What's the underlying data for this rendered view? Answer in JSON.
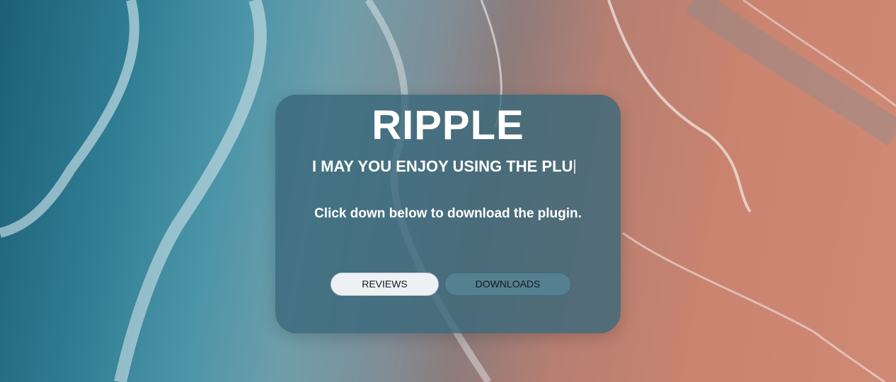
{
  "hero": {
    "title": "RIPPLE",
    "typing_text": "I MAY YOU ENJOY USING THE PLU",
    "description": "Click down below to download the plugin.",
    "background": "beach-waves-photo"
  },
  "buttons": {
    "reviews_label": "REVIEWS",
    "downloads_label": "DOWNLOADS"
  },
  "colors": {
    "ocean": "#2f7d93",
    "sand": "#c9836f",
    "card": "#38687a",
    "reviews_button": "#eef1f4",
    "downloads_button": "#55808f"
  }
}
